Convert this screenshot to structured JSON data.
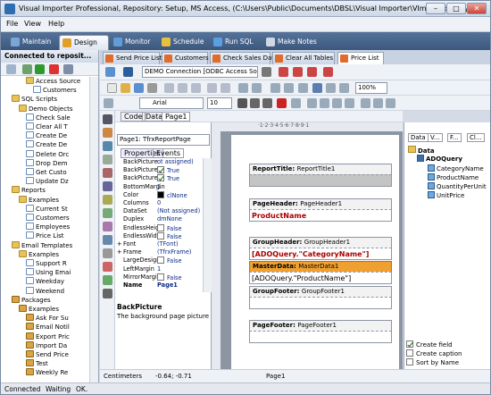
{
  "window": {
    "title": "Visual Importer Professional, Repository: Setup, MS Access, (C:\\Users\\Public\\Documents\\DBSL\\Visual Importer\\VImpRepository.m...",
    "min": "–",
    "max": "□",
    "close": "✕"
  },
  "menu": [
    "File",
    "View",
    "Help"
  ],
  "main_tabs": [
    {
      "label": "Maintain",
      "icon": "wrench-icon",
      "color": "#7aa6d6"
    },
    {
      "label": "Design",
      "icon": "paint-icon",
      "color": "#e0a028"
    },
    {
      "label": "Monitor",
      "icon": "monitor-icon",
      "color": "#5f9ed8"
    },
    {
      "label": "Schedule",
      "icon": "clock-icon",
      "color": "#e8c040"
    },
    {
      "label": "Run SQL",
      "icon": "sql-icon",
      "color": "#5aa0e0"
    },
    {
      "label": "Make Notes",
      "icon": "notes-icon",
      "color": "#cfd8e4"
    }
  ],
  "left_panel": {
    "header": "Connected to reposit...",
    "tree": [
      {
        "label": "Access Source",
        "level": 3,
        "type": "fold"
      },
      {
        "label": "Customers",
        "level": 4,
        "type": "page"
      },
      {
        "label": "SQL Scripts",
        "level": 1,
        "type": "fold"
      },
      {
        "label": "Demo Objects",
        "level": 2,
        "type": "fold"
      },
      {
        "label": "Check Sale",
        "level": 3,
        "type": "page"
      },
      {
        "label": "Clear All T",
        "level": 3,
        "type": "page"
      },
      {
        "label": "Create De",
        "level": 3,
        "type": "page"
      },
      {
        "label": "Create De",
        "level": 3,
        "type": "page"
      },
      {
        "label": "Delete Orc",
        "level": 3,
        "type": "page"
      },
      {
        "label": "Drop Dem",
        "level": 3,
        "type": "page"
      },
      {
        "label": "Get Custo",
        "level": 3,
        "type": "page"
      },
      {
        "label": "Update Dz",
        "level": 3,
        "type": "page"
      },
      {
        "label": "Reports",
        "level": 1,
        "type": "fold"
      },
      {
        "label": "Examples",
        "level": 2,
        "type": "fold"
      },
      {
        "label": "Current St",
        "level": 3,
        "type": "page"
      },
      {
        "label": "Customers",
        "level": 3,
        "type": "page"
      },
      {
        "label": "Employees",
        "level": 3,
        "type": "page"
      },
      {
        "label": "Price List",
        "level": 3,
        "type": "page"
      },
      {
        "label": "Email Templates",
        "level": 1,
        "type": "fold"
      },
      {
        "label": "Examples",
        "level": 2,
        "type": "fold"
      },
      {
        "label": "Support R",
        "level": 3,
        "type": "page"
      },
      {
        "label": "Using Emai",
        "level": 3,
        "type": "page"
      },
      {
        "label": "Weekday",
        "level": 3,
        "type": "page"
      },
      {
        "label": "Weekend",
        "level": 3,
        "type": "page"
      },
      {
        "label": "Packages",
        "level": 1,
        "type": "pack"
      },
      {
        "label": "Examples",
        "level": 2,
        "type": "pack"
      },
      {
        "label": "Ask For Su",
        "level": 3,
        "type": "pack"
      },
      {
        "label": "Email Notil",
        "level": 3,
        "type": "pack"
      },
      {
        "label": "Export Pric",
        "level": 3,
        "type": "pack"
      },
      {
        "label": "Import Da",
        "level": 3,
        "type": "pack"
      },
      {
        "label": "Send Price",
        "level": 3,
        "type": "pack"
      },
      {
        "label": "Test",
        "level": 3,
        "type": "pack"
      },
      {
        "label": "Weekly Re",
        "level": 3,
        "type": "pack"
      }
    ]
  },
  "doc_tabs": [
    "Send Price List",
    "Customers",
    "Check Sales Data",
    "Clear All Tables",
    "Price List"
  ],
  "connection": "DEMO Connection [ODBC Access Source",
  "font": {
    "name": "Arial",
    "size": "10",
    "zoom": "100%"
  },
  "subtabs": [
    "Code",
    "Data",
    "Page1"
  ],
  "inspector": {
    "object": "Page1: TfrxReportPage",
    "tabs": [
      "Properties",
      "Events"
    ],
    "props": [
      {
        "k": "BackPicture",
        "v": "ot assigned)"
      },
      {
        "k": "BackPictureP",
        "v": "True",
        "cb": true
      },
      {
        "k": "BackPictureV",
        "v": "True",
        "cb": true
      },
      {
        "k": "BottomMargin",
        "v": "1"
      },
      {
        "k": "Color",
        "v": "clNone",
        "sw": true
      },
      {
        "k": "Columns",
        "v": "0"
      },
      {
        "k": "DataSet",
        "v": "(Not assigned)"
      },
      {
        "k": "Duplex",
        "v": "dmNone"
      },
      {
        "k": "EndlessHeigh",
        "v": "False",
        "cb": false
      },
      {
        "k": "EndlessWidt",
        "v": "False",
        "cb": false
      },
      {
        "k": "Font",
        "v": "(TFont)",
        "plus": true
      },
      {
        "k": "Frame",
        "v": "(TfrxFrame)",
        "plus": true
      },
      {
        "k": "LargeDesign",
        "v": "False",
        "cb": false
      },
      {
        "k": "LeftMargin",
        "v": "1"
      },
      {
        "k": "MirrorMargin",
        "v": "False",
        "cb": false
      },
      {
        "k": "Name",
        "v": "Page1",
        "bold": true
      }
    ],
    "help_title": "BackPicture",
    "help_text": "The background page picture"
  },
  "design": {
    "ruler": "·1·2·3·4·5·6·7·8·9·1",
    "bands": [
      {
        "title": "ReportTitle:",
        "sub": "ReportTitle1",
        "text": ""
      },
      {
        "title": "PageHeader:",
        "sub": "PageHeader1",
        "text": "ProductName"
      },
      {
        "title": "GroupHeader:",
        "sub": "GroupHeader1",
        "text": "[ADOQuery.\"CategoryName\"]"
      },
      {
        "title": "MasterData:",
        "sub": "MasterData1",
        "text": "[ADOQuery.\"ProductName\"]"
      },
      {
        "title": "GroupFooter:",
        "sub": "GroupFooter1",
        "text": ""
      },
      {
        "title": "PageFooter:",
        "sub": "PageFooter1",
        "text": ""
      }
    ]
  },
  "right": {
    "tabs": [
      "Data",
      "V...",
      "F...",
      "Cl..."
    ],
    "root": "Data",
    "query": "ADOQuery",
    "fields": [
      "CategoryName",
      "ProductName",
      "QuantityPerUnit",
      "UnitPrice"
    ],
    "checks": [
      {
        "label": "Create field",
        "on": true
      },
      {
        "label": "Create caption",
        "on": false
      },
      {
        "label": "Sort by Name",
        "on": false
      }
    ]
  },
  "bottom": {
    "units": "Centimeters",
    "coords": "-0.64; -0.71",
    "page": "Page1"
  },
  "status": {
    "a": "Connected",
    "b": "Waiting",
    "c": "OK."
  }
}
